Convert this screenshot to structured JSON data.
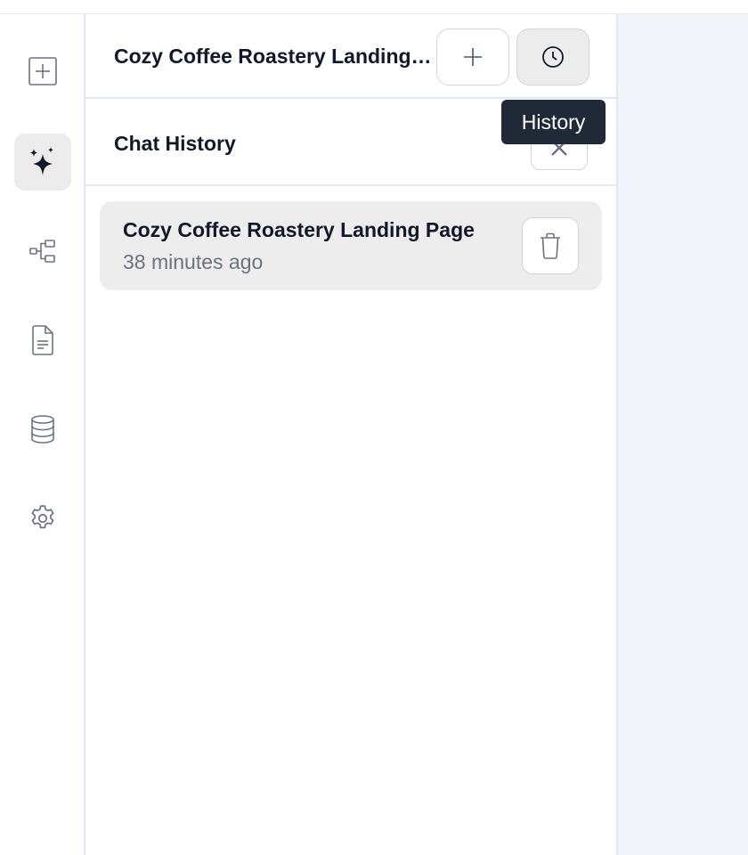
{
  "sidebar": {
    "items": [
      {
        "name": "new-project",
        "icon": "plus-square-icon"
      },
      {
        "name": "ai-assistant",
        "icon": "sparkles-icon",
        "active": true
      },
      {
        "name": "workflow",
        "icon": "hierarchy-icon"
      },
      {
        "name": "documents",
        "icon": "document-icon"
      },
      {
        "name": "database",
        "icon": "database-icon"
      },
      {
        "name": "settings",
        "icon": "gear-icon"
      }
    ]
  },
  "header": {
    "chat_title": "Cozy Coffee Roastery Landing Page",
    "new_chat_icon": "plus-icon",
    "history_icon": "clock-icon"
  },
  "tooltip": {
    "text": "History"
  },
  "history": {
    "title": "Chat History",
    "close_icon": "close-icon",
    "items": [
      {
        "title": "Cozy Coffee Roastery Landing Page",
        "time": "38 minutes ago",
        "delete_icon": "trash-icon"
      }
    ]
  },
  "colors": {
    "active_bg": "#ececec",
    "border": "#e2e8f0",
    "tooltip_bg": "#1f2937",
    "muted_text": "#6b7280",
    "right_area_bg": "#f1f5f9"
  }
}
